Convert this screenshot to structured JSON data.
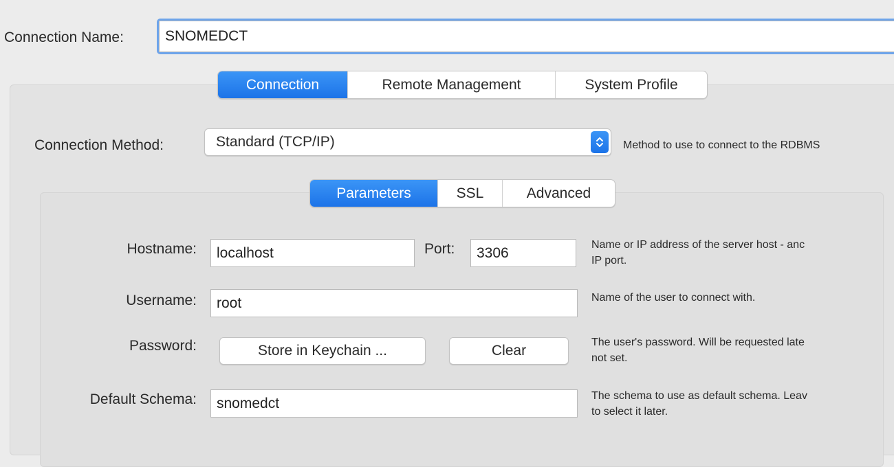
{
  "connection_name": {
    "label": "Connection Name:",
    "value": "SNOMEDCT"
  },
  "top_tabs": [
    {
      "label": "Connection",
      "active": true
    },
    {
      "label": "Remote Management",
      "active": false
    },
    {
      "label": "System Profile",
      "active": false
    }
  ],
  "connection_method": {
    "label": "Connection Method:",
    "value": "Standard (TCP/IP)",
    "hint": "Method to use to connect to the RDBMS"
  },
  "sub_tabs": [
    {
      "label": "Parameters",
      "active": true
    },
    {
      "label": "SSL",
      "active": false
    },
    {
      "label": "Advanced",
      "active": false
    }
  ],
  "parameters": {
    "hostname": {
      "label": "Hostname:",
      "value": "localhost",
      "hint_lines": [
        "Name or IP address of the server host - anc",
        "IP port."
      ]
    },
    "port": {
      "label": "Port:",
      "value": "3306"
    },
    "username": {
      "label": "Username:",
      "value": "root",
      "hint_lines": [
        "Name of the user to connect with."
      ]
    },
    "password": {
      "label": "Password:",
      "store_button": "Store in Keychain ...",
      "clear_button": "Clear",
      "hint_lines": [
        "The user's password. Will be requested late",
        "not set."
      ]
    },
    "default_schema": {
      "label": "Default Schema:",
      "value": "snomedct",
      "hint_lines": [
        "The schema to use as default schema. Leav",
        "to select it later."
      ]
    }
  },
  "colors": {
    "accent": "#1f77ea",
    "focus_ring": "#6ea4ea",
    "window_bg": "#ececec",
    "panel_bg": "#e3e3e3"
  }
}
